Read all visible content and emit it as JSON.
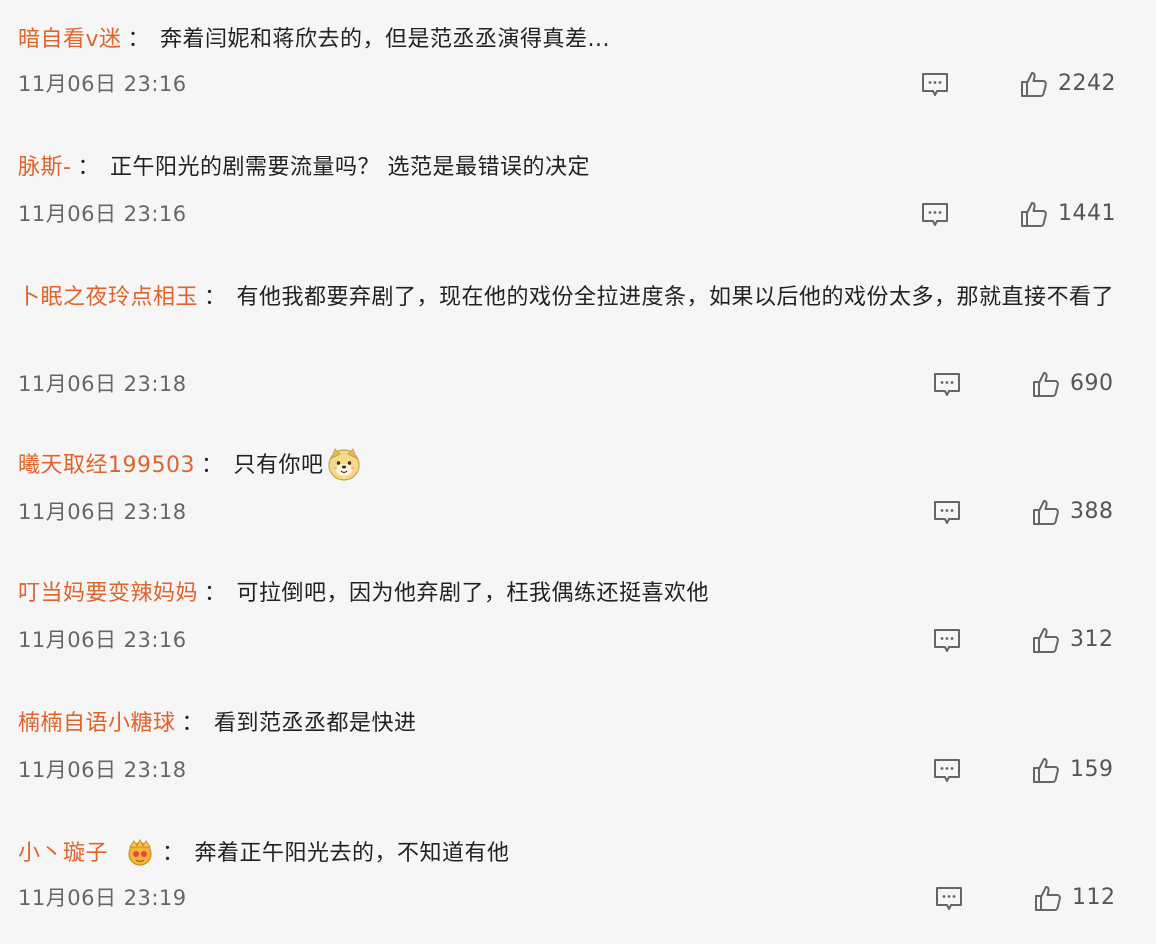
{
  "comments": [
    {
      "username": "暗自看v迷",
      "colon": "：",
      "text": "奔着闫妮和蒋欣去的，但是范丞丞演得真差...",
      "time": "11月06日 23:16",
      "likes": "2242"
    },
    {
      "username": "脉斯-",
      "colon": "：",
      "text": "正午阳光的剧需要流量吗？ 选范是最错误的决定",
      "time": "11月06日 23:16",
      "likes": "1441"
    },
    {
      "username": "卜眠之夜玲点相玉",
      "colon": "：",
      "text": "有他我都要弃剧了，现在他的戏份全拉进度条，如果以后他的戏份太多，那就直接不看了",
      "time": "11月06日 23:18",
      "likes": "690"
    },
    {
      "username": "曦天取经199503",
      "colon": "：",
      "text": "只有你吧",
      "time": "11月06日 23:18",
      "likes": "388",
      "emoji": "dog-face-emoji"
    },
    {
      "username": "叮当妈要变辣妈妈",
      "colon": "：",
      "text": "可拉倒吧，因为他弃剧了，枉我偶练还挺喜欢他",
      "time": "11月06日 23:16",
      "likes": "312"
    },
    {
      "username": "楠楠自语小糖球",
      "colon": "：",
      "text": "看到范丞丞都是快进",
      "time": "11月06日 23:18",
      "likes": "159"
    },
    {
      "username": "小丶璇子",
      "colon": "：",
      "text": "奔着正午阳光去的，不知道有他",
      "time": "11月06日 23:19",
      "likes": "112",
      "badge": "crown-badge-icon"
    }
  ],
  "colors": {
    "username": "#e0632b",
    "text": "#222222",
    "meta": "#666666",
    "icon": "#666666",
    "background": "#f6f6f6"
  },
  "icons": {
    "reply": "comment-bubble-icon",
    "like": "thumbs-up-icon"
  }
}
